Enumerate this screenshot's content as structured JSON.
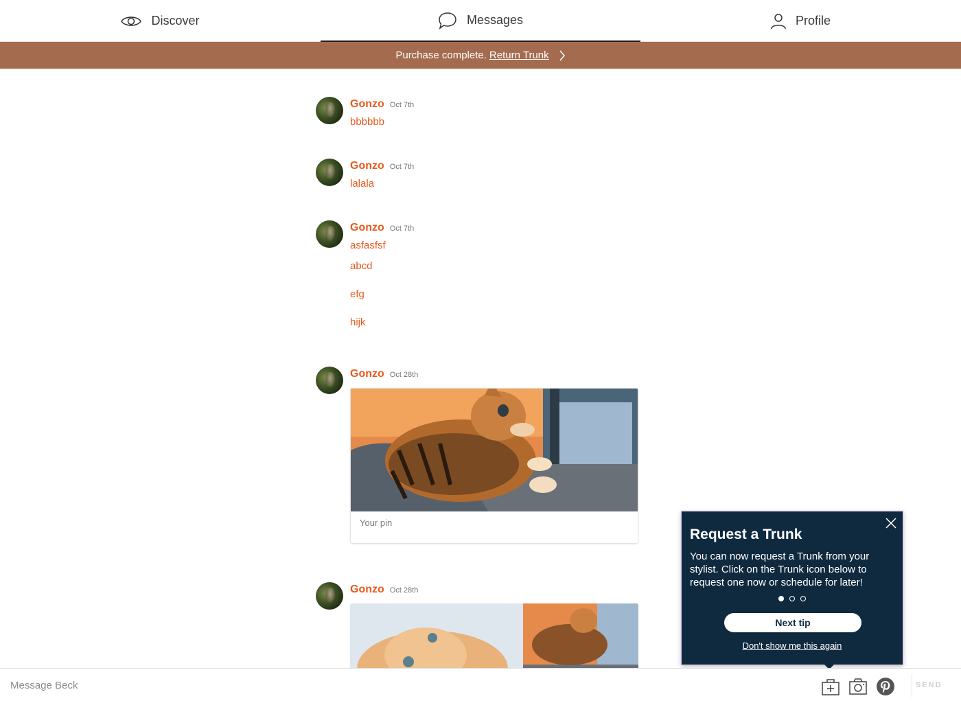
{
  "nav": {
    "discover_label": "Discover",
    "messages_label": "Messages",
    "profile_label": "Profile",
    "active_tab": "Messages"
  },
  "banner": {
    "text": "Purchase complete.",
    "link_label": "Return Trunk",
    "color": "#a56b4e"
  },
  "messages": [
    {
      "sender": "Gonzo",
      "date": "Oct 7th",
      "lines": [
        "bbbbbb"
      ]
    },
    {
      "sender": "Gonzo",
      "date": "Oct 7th",
      "lines": [
        "lalala"
      ]
    },
    {
      "sender": "Gonzo",
      "date": "Oct 7th",
      "lines": [
        "asfasfsf",
        "abcd",
        "efg",
        "hijk"
      ]
    },
    {
      "sender": "Gonzo",
      "date": "Oct 28th",
      "pin_caption": "Your pin"
    },
    {
      "sender": "Gonzo",
      "date": "Oct 28th"
    }
  ],
  "accent_color": "#e85a1e",
  "tip": {
    "title": "Request a Trunk",
    "body": "You can now request a Trunk from your stylist. Click on the Trunk icon below to request one now or schedule for later!",
    "next_label": "Next tip",
    "dismiss_label": "Don't show me this again",
    "current_step": 1,
    "total_steps": 3,
    "background": "#0f2a3f"
  },
  "composer": {
    "placeholder": "Message Beck",
    "value": "",
    "send_label": "SEND",
    "icons": [
      "trunk-add-icon",
      "camera-icon",
      "pinterest-icon"
    ]
  }
}
